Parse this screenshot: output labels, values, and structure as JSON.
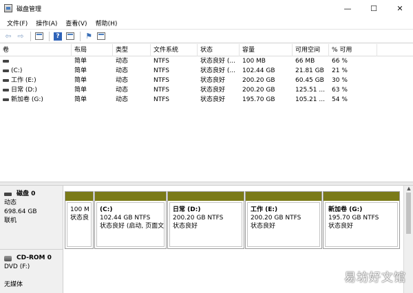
{
  "window": {
    "title": "磁盘管理"
  },
  "controls": {
    "minimize": "—",
    "maximize": "☐",
    "close": "✕"
  },
  "menu": [
    "文件(F)",
    "操作(A)",
    "查看(V)",
    "帮助(H)"
  ],
  "columns": [
    "卷",
    "布局",
    "类型",
    "文件系统",
    "状态",
    "容量",
    "可用空间",
    "% 可用"
  ],
  "volumes": [
    {
      "name": "",
      "layout": "简单",
      "type": "动态",
      "fs": "NTFS",
      "status": "状态良好 (...",
      "capacity": "100 MB",
      "free": "66 MB",
      "pct": "66 %"
    },
    {
      "name": "(C:)",
      "layout": "简单",
      "type": "动态",
      "fs": "NTFS",
      "status": "状态良好 (...",
      "capacity": "102.44 GB",
      "free": "21.81 GB",
      "pct": "21 %"
    },
    {
      "name": "工作 (E:)",
      "layout": "简单",
      "type": "动态",
      "fs": "NTFS",
      "status": "状态良好",
      "capacity": "200.20 GB",
      "free": "60.45 GB",
      "pct": "30 %"
    },
    {
      "name": "日常 (D:)",
      "layout": "简单",
      "type": "动态",
      "fs": "NTFS",
      "status": "状态良好",
      "capacity": "200.20 GB",
      "free": "125.51 ...",
      "pct": "63 %"
    },
    {
      "name": "新加卷 (G:)",
      "layout": "简单",
      "type": "动态",
      "fs": "NTFS",
      "status": "状态良好",
      "capacity": "195.70 GB",
      "free": "105.21 ...",
      "pct": "54 %"
    }
  ],
  "disk0": {
    "title": "磁盘 0",
    "kind": "动态",
    "size": "698.64 GB",
    "state": "联机",
    "partitions": [
      {
        "name": "",
        "size": "100 M",
        "status": "状态良"
      },
      {
        "name": "(C:)",
        "size": "102.44 GB NTFS",
        "status": "状态良好 (启动, 页面文"
      },
      {
        "name": "日常 (D:)",
        "size": "200.20 GB NTFS",
        "status": "状态良好"
      },
      {
        "name": "工作 (E:)",
        "size": "200.20 GB NTFS",
        "status": "状态良好"
      },
      {
        "name": "新加卷 (G:)",
        "size": "195.70 GB NTFS",
        "status": "状态良好"
      }
    ]
  },
  "cdrom": {
    "title": "CD-ROM 0",
    "kind": "DVD (F:)",
    "media": "无媒体"
  },
  "watermark": "易坊好文馆",
  "colors": {
    "partition_bar": "#7a7a18",
    "toolbar_icon": "#3a6fb6"
  }
}
